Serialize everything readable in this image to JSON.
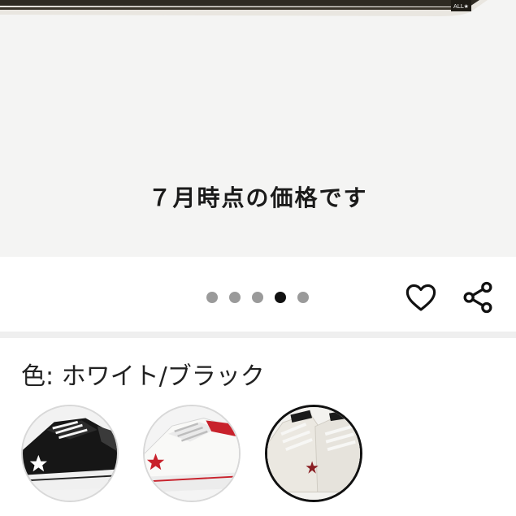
{
  "carousel": {
    "caption": "７月時点の価格です",
    "page_count": 5,
    "active_index": 3
  },
  "actions": {
    "favorite_icon": "heart-outline-icon",
    "share_icon": "share-icon"
  },
  "color": {
    "label": "色: ホワイト/ブラック",
    "options": [
      {
        "name": "black-leather-sneaker",
        "selected": false
      },
      {
        "name": "white-red-star-sneaker",
        "selected": false
      },
      {
        "name": "white-black-sneaker",
        "selected": true
      }
    ]
  },
  "colors": {
    "dot_inactive": "#9a9a9a",
    "dot_active": "#111111",
    "selected_ring": "#111111"
  }
}
